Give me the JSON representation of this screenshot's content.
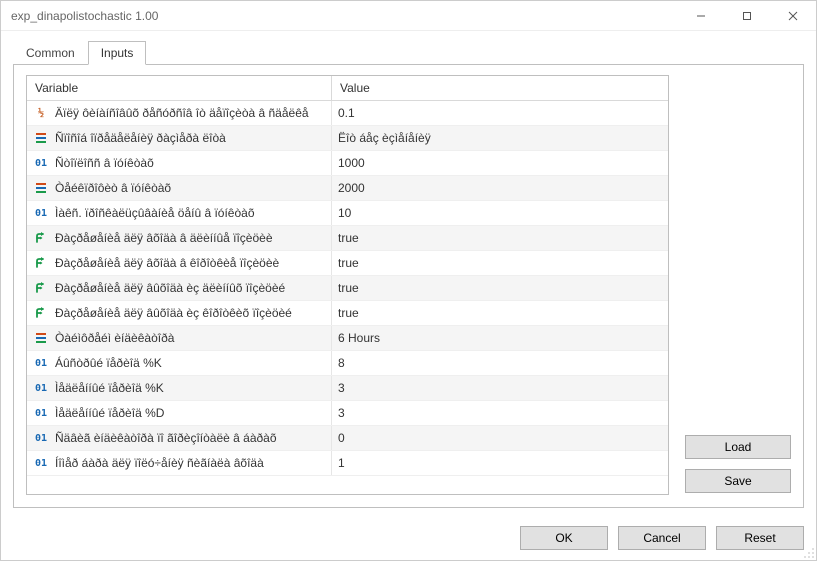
{
  "window": {
    "title": "exp_dinapolistochastic 1.00"
  },
  "tabs": {
    "common": "Common",
    "inputs": "Inputs",
    "active": "inputs"
  },
  "headers": {
    "variable": "Variable",
    "value": "Value"
  },
  "rows": [
    {
      "icon": "half",
      "name": "Äïëÿ ôèíàíñîâûõ ðåñóðñîâ îò äåïîçèòà â ñäåëêå",
      "value": "0.1"
    },
    {
      "icon": "enum",
      "name": "Ñïîñîá îïðåäåëåíèÿ ðàçìåðà ëîòà",
      "value": "Ëîò áåç èçìåíåíèÿ"
    },
    {
      "icon": "int",
      "name": "Ñòîïëîññ â ïóíêòàõ",
      "value": "1000"
    },
    {
      "icon": "enum",
      "name": "Òåéêïðîôèò â ïóíêòàõ",
      "value": "2000"
    },
    {
      "icon": "int",
      "name": "Ìàêñ. ïðîñêàëüçûâàíèå öåíû â ïóíêòàõ",
      "value": "10"
    },
    {
      "icon": "bool",
      "name": "Ðàçðåøåíèå äëÿ âõîäà â äëèííûå ïîçèöèè",
      "value": "true"
    },
    {
      "icon": "bool",
      "name": "Ðàçðåøåíèå äëÿ âõîäà â êîðîòêèå ïîçèöèè",
      "value": "true"
    },
    {
      "icon": "bool",
      "name": "Ðàçðåøåíèå äëÿ âûõîäà èç äëèííûõ ïîçèöèé",
      "value": "true"
    },
    {
      "icon": "bool",
      "name": "Ðàçðåøåíèå äëÿ âûõîäà èç êîðîòêèõ ïîçèöèé",
      "value": "true"
    },
    {
      "icon": "enum",
      "name": "Òàéìôðåéì èíäèêàòîðà",
      "value": "6 Hours"
    },
    {
      "icon": "int",
      "name": "Áûñòðûé ïåðèîä %K",
      "value": "8"
    },
    {
      "icon": "int",
      "name": "Ìåäëåííûé ïåðèîä %K",
      "value": "3"
    },
    {
      "icon": "int",
      "name": "Ìåäëåííûé ïåðèîä %D",
      "value": "3"
    },
    {
      "icon": "int",
      "name": "Ñäâèã èíäèêàòîðà ïî ãîðèçîíòàëè â áàðàõ",
      "value": "0"
    },
    {
      "icon": "int",
      "name": "Íîìåð áàðà äëÿ ïîëó÷åíèÿ ñèãíàëà âõîäà",
      "value": "1"
    }
  ],
  "sideButtons": {
    "load": "Load",
    "save": "Save"
  },
  "footerButtons": {
    "ok": "OK",
    "cancel": "Cancel",
    "reset": "Reset"
  }
}
